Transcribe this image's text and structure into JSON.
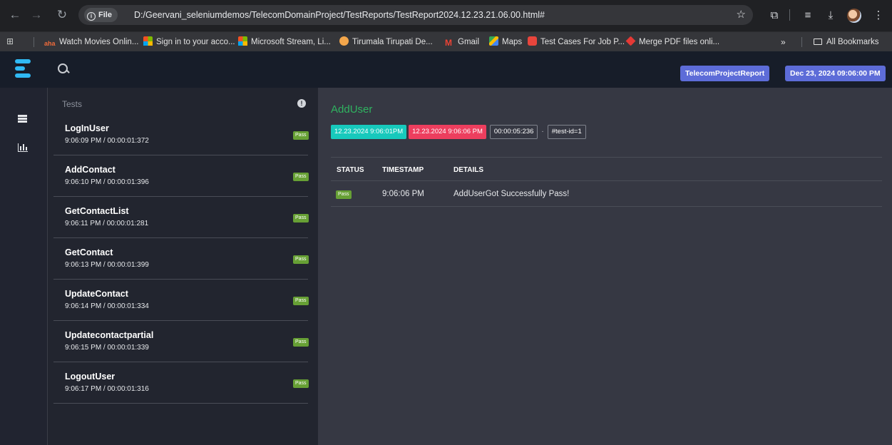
{
  "browser": {
    "address_chip": "File",
    "url": "D:/Geervani_seleniumdemos/TelecomDomainProject/TestReports/TestReport2024.12.23.21.06.00.html#",
    "bookmarks": [
      {
        "label": "Watch Movies Onlin...",
        "icon": "aha-icon"
      },
      {
        "label": "Sign in to your acco...",
        "icon": "microsoft-icon"
      },
      {
        "label": "Microsoft Stream, Li...",
        "icon": "microsoft-icon"
      },
      {
        "label": "Tirumala Tirupati De...",
        "icon": "ttd-icon"
      },
      {
        "label": "Gmail",
        "icon": "gmail-icon"
      },
      {
        "label": "Maps",
        "icon": "maps-icon"
      },
      {
        "label": "Test Cases For Job P...",
        "icon": "testcases-icon"
      },
      {
        "label": "Merge PDF files onli...",
        "icon": "pdf-icon"
      }
    ],
    "more_label": "»",
    "all_bookmarks": "All Bookmarks",
    "aha_logo_text": "aha"
  },
  "header": {
    "report_name": "TelecomProjectReport",
    "report_date": "Dec 23, 2024 09:06:00 PM"
  },
  "test_panel": {
    "heading": "Tests",
    "tests": [
      {
        "name": "LogInUser",
        "meta": "9:06:09 PM / 00:00:01:372",
        "status": "Pass"
      },
      {
        "name": "AddContact",
        "meta": "9:06:10 PM / 00:00:01:396",
        "status": "Pass"
      },
      {
        "name": "GetContactList",
        "meta": "9:06:11 PM / 00:00:01:281",
        "status": "Pass"
      },
      {
        "name": "GetContact",
        "meta": "9:06:13 PM / 00:00:01:399",
        "status": "Pass"
      },
      {
        "name": "UpdateContact",
        "meta": "9:06:14 PM / 00:00:01:334",
        "status": "Pass"
      },
      {
        "name": "Updatecontactpartial",
        "meta": "9:06:15 PM / 00:00:01:339",
        "status": "Pass"
      },
      {
        "name": "LogoutUser",
        "meta": "9:06:17 PM / 00:00:01:316",
        "status": "Pass"
      }
    ]
  },
  "detail": {
    "title": "AddUser",
    "start_time": "12.23.2024 9:06:01PM",
    "end_time": "12.23.2024 9:06:06 PM",
    "duration": "00:00:05:236",
    "separator": "·",
    "test_id": "#test-id=1",
    "columns": [
      "STATUS",
      "TIMESTAMP",
      "DETAILS"
    ],
    "logs": [
      {
        "status": "Pass",
        "timestamp": "9:06:06 PM",
        "details": "AddUserGot Successfully Pass!"
      }
    ]
  },
  "colors": {
    "accent_green": "#2fb360",
    "pass": "#67a035",
    "start_chip": "#17c9bc",
    "end_chip": "#ed3e5e",
    "header_badge": "#5d6cd8",
    "logo": "#30b9f3"
  }
}
